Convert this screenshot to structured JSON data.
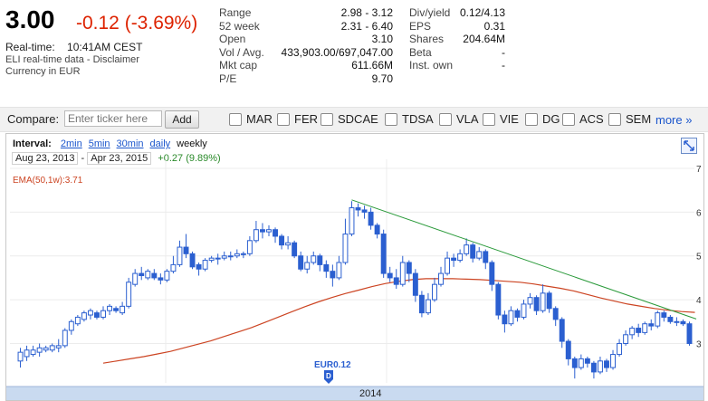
{
  "quote": {
    "price": "3.00",
    "change": "-0.12 (-3.69%)",
    "realtime_label": "Real-time:",
    "realtime_value": "10:41AM CEST",
    "data_note": "ELI real-time data - Disclaimer",
    "currency_note": "Currency in EUR"
  },
  "stats_left": [
    {
      "label": "Range",
      "value": "2.98 - 3.12"
    },
    {
      "label": "52 week",
      "value": "2.31 - 6.40"
    },
    {
      "label": "Open",
      "value": "3.10"
    },
    {
      "label": "Vol / Avg.",
      "value": "433,903.00/697,047.00"
    },
    {
      "label": "Mkt cap",
      "value": "611.66M"
    },
    {
      "label": "P/E",
      "value": "9.70"
    }
  ],
  "stats_right": [
    {
      "label": "Div/yield",
      "value": "0.12/4.13"
    },
    {
      "label": "EPS",
      "value": "0.31"
    },
    {
      "label": "Shares",
      "value": "204.64M"
    },
    {
      "label": "Beta",
      "value": "-"
    },
    {
      "label": "Inst. own",
      "value": "-"
    }
  ],
  "compare": {
    "label": "Compare:",
    "placeholder": "Enter ticker here",
    "add_label": "Add",
    "tickers": [
      "MAR",
      "FER",
      "SDCAE",
      "TDSA",
      "VLA",
      "VIE",
      "DG",
      "ACS",
      "SEM"
    ],
    "more_label": "more »"
  },
  "chart_controls": {
    "interval_label": "Interval:",
    "intervals": [
      "2min",
      "5min",
      "30min",
      "daily",
      "weekly"
    ],
    "selected_interval": "weekly",
    "range_start": "Aug 23, 2013",
    "range_sep": "-",
    "range_end": "Apr 23, 2015",
    "range_change": "+0.27 (9.89%)",
    "ema_label": "EMA(50,1w):3.71",
    "dividend_marker": "EUR0.12",
    "dividend_letter": "D",
    "year_label": "2014"
  },
  "colors": {
    "down": "#dd2200",
    "up": "#2a8a2a",
    "candle": "#2b5fd0",
    "ema": "#cc4422",
    "trend": "#2a9a3a",
    "link": "#1a55cc"
  },
  "chart_data": {
    "type": "candlestick",
    "x_range": [
      "Aug 23, 2013",
      "Apr 23, 2015"
    ],
    "y_ticks": [
      3,
      4,
      5,
      6,
      7
    ],
    "ylim": [
      2.1,
      7.0
    ],
    "candles": [
      [
        2.6,
        2.8,
        2.45,
        2.9
      ],
      [
        2.7,
        2.85,
        2.6,
        2.95
      ],
      [
        2.75,
        2.85,
        2.7,
        2.95
      ],
      [
        2.8,
        2.9,
        2.7,
        3.0
      ],
      [
        2.85,
        2.9,
        2.8,
        2.95
      ],
      [
        2.85,
        2.95,
        2.8,
        3.0
      ],
      [
        2.9,
        2.95,
        2.8,
        3.1
      ],
      [
        2.95,
        3.3,
        2.9,
        3.35
      ],
      [
        3.3,
        3.5,
        3.2,
        3.55
      ],
      [
        3.45,
        3.6,
        3.4,
        3.65
      ],
      [
        3.55,
        3.7,
        3.5,
        3.75
      ],
      [
        3.65,
        3.75,
        3.55,
        3.8
      ],
      [
        3.7,
        3.6,
        3.55,
        3.75
      ],
      [
        3.6,
        3.75,
        3.55,
        3.85
      ],
      [
        3.75,
        3.85,
        3.65,
        3.9
      ],
      [
        3.8,
        3.75,
        3.7,
        3.85
      ],
      [
        3.7,
        3.85,
        3.65,
        3.95
      ],
      [
        3.85,
        4.4,
        3.8,
        4.5
      ],
      [
        4.35,
        4.6,
        4.3,
        4.7
      ],
      [
        4.6,
        4.55,
        4.45,
        4.75
      ],
      [
        4.5,
        4.65,
        4.45,
        4.7
      ],
      [
        4.6,
        4.5,
        4.45,
        4.7
      ],
      [
        4.5,
        4.45,
        4.35,
        4.6
      ],
      [
        4.45,
        4.65,
        4.4,
        4.7
      ],
      [
        4.65,
        4.8,
        4.6,
        5.0
      ],
      [
        4.8,
        5.2,
        4.75,
        5.35
      ],
      [
        5.2,
        5.05,
        4.95,
        5.5
      ],
      [
        5.05,
        4.75,
        4.7,
        5.1
      ],
      [
        4.8,
        4.7,
        4.55,
        4.85
      ],
      [
        4.7,
        4.9,
        4.65,
        4.95
      ],
      [
        4.9,
        4.95,
        4.85,
        5.0
      ],
      [
        4.95,
        4.95,
        4.8,
        5.05
      ],
      [
        4.95,
        5.0,
        4.9,
        5.1
      ],
      [
        5.0,
        5.0,
        4.9,
        5.1
      ],
      [
        5.0,
        5.05,
        4.95,
        5.15
      ],
      [
        5.05,
        5.05,
        4.95,
        5.1
      ],
      [
        5.05,
        5.35,
        5.0,
        5.45
      ],
      [
        5.35,
        5.6,
        5.3,
        5.8
      ],
      [
        5.6,
        5.55,
        5.4,
        5.75
      ],
      [
        5.55,
        5.6,
        5.45,
        5.7
      ],
      [
        5.6,
        5.45,
        5.3,
        5.65
      ],
      [
        5.45,
        5.25,
        5.15,
        5.5
      ],
      [
        5.25,
        5.3,
        5.15,
        5.45
      ],
      [
        5.3,
        5.0,
        4.95,
        5.35
      ],
      [
        5.0,
        4.7,
        4.65,
        5.1
      ],
      [
        4.7,
        4.85,
        4.6,
        5.0
      ],
      [
        4.85,
        5.0,
        4.8,
        5.1
      ],
      [
        5.0,
        4.8,
        4.65,
        5.05
      ],
      [
        4.8,
        4.65,
        4.5,
        4.9
      ],
      [
        4.65,
        4.5,
        4.3,
        4.8
      ],
      [
        4.5,
        4.85,
        4.45,
        5.0
      ],
      [
        4.85,
        5.5,
        4.8,
        5.85
      ],
      [
        5.5,
        6.1,
        5.45,
        6.25
      ],
      [
        6.1,
        6.05,
        5.9,
        6.2
      ],
      [
        6.05,
        6.0,
        5.85,
        6.15
      ],
      [
        6.0,
        5.7,
        5.6,
        6.1
      ],
      [
        5.7,
        5.5,
        5.4,
        5.75
      ],
      [
        5.5,
        4.6,
        4.5,
        5.6
      ],
      [
        4.6,
        4.5,
        4.4,
        4.75
      ],
      [
        4.5,
        4.35,
        4.25,
        4.7
      ],
      [
        4.35,
        4.85,
        4.3,
        5.0
      ],
      [
        4.85,
        4.6,
        4.4,
        4.9
      ],
      [
        4.6,
        4.1,
        3.95,
        4.7
      ],
      [
        4.1,
        3.7,
        3.6,
        4.2
      ],
      [
        3.7,
        4.0,
        3.65,
        4.15
      ],
      [
        4.0,
        4.35,
        3.95,
        4.5
      ],
      [
        4.35,
        4.6,
        4.3,
        4.75
      ],
      [
        4.6,
        4.95,
        4.55,
        5.1
      ],
      [
        4.95,
        4.9,
        4.75,
        5.05
      ],
      [
        4.9,
        5.05,
        4.85,
        5.15
      ],
      [
        5.05,
        5.25,
        5.0,
        5.4
      ],
      [
        5.25,
        4.95,
        4.85,
        5.3
      ],
      [
        4.95,
        5.1,
        4.9,
        5.2
      ],
      [
        5.1,
        4.85,
        4.7,
        5.15
      ],
      [
        4.85,
        4.35,
        4.2,
        4.9
      ],
      [
        4.35,
        3.65,
        3.55,
        4.4
      ],
      [
        3.65,
        3.45,
        3.25,
        3.75
      ],
      [
        3.45,
        3.75,
        3.4,
        3.85
      ],
      [
        3.75,
        3.6,
        3.5,
        3.8
      ],
      [
        3.6,
        3.9,
        3.55,
        4.0
      ],
      [
        3.9,
        4.05,
        3.8,
        4.15
      ],
      [
        4.05,
        3.75,
        3.65,
        4.1
      ],
      [
        3.75,
        4.15,
        3.7,
        4.35
      ],
      [
        4.15,
        3.8,
        3.7,
        4.2
      ],
      [
        3.8,
        3.55,
        3.4,
        3.85
      ],
      [
        3.55,
        3.05,
        2.9,
        3.6
      ],
      [
        3.05,
        2.65,
        2.5,
        3.1
      ],
      [
        2.65,
        2.45,
        2.2,
        2.7
      ],
      [
        2.45,
        2.65,
        2.4,
        2.75
      ],
      [
        2.65,
        2.55,
        2.45,
        2.7
      ],
      [
        2.55,
        2.35,
        2.2,
        2.6
      ],
      [
        2.35,
        2.6,
        2.3,
        2.7
      ],
      [
        2.6,
        2.45,
        2.35,
        2.65
      ],
      [
        2.45,
        2.75,
        2.4,
        2.85
      ],
      [
        2.75,
        3.0,
        2.7,
        3.1
      ],
      [
        3.0,
        3.2,
        2.95,
        3.3
      ],
      [
        3.2,
        3.35,
        3.1,
        3.4
      ],
      [
        3.35,
        3.25,
        3.15,
        3.45
      ],
      [
        3.25,
        3.45,
        3.2,
        3.5
      ],
      [
        3.45,
        3.4,
        3.3,
        3.55
      ],
      [
        3.4,
        3.7,
        3.35,
        3.75
      ],
      [
        3.7,
        3.6,
        3.5,
        3.75
      ],
      [
        3.6,
        3.5,
        3.45,
        3.65
      ],
      [
        3.5,
        3.5,
        3.4,
        3.6
      ],
      [
        3.5,
        3.45,
        3.4,
        3.55
      ],
      [
        3.45,
        3.0,
        2.95,
        3.5
      ]
    ],
    "ema": [
      2.55,
      2.6,
      2.65,
      2.7,
      2.76,
      2.82,
      2.9,
      2.98,
      3.06,
      3.16,
      3.26,
      3.36,
      3.48,
      3.6,
      3.72,
      3.84,
      3.95,
      4.05,
      4.14,
      4.22,
      4.3,
      4.37,
      4.42,
      4.46,
      4.48,
      4.48,
      4.48,
      4.47,
      4.46,
      4.44,
      4.42,
      4.4,
      4.36,
      4.31,
      4.26,
      4.2,
      4.12,
      4.04,
      3.97,
      3.9,
      3.85,
      3.8,
      3.76,
      3.73,
      3.71
    ],
    "trendline": [
      [
        6.28
      ],
      [
        3.56
      ]
    ],
    "dividend": {
      "label": "EUR0.12",
      "marker": "D"
    }
  }
}
